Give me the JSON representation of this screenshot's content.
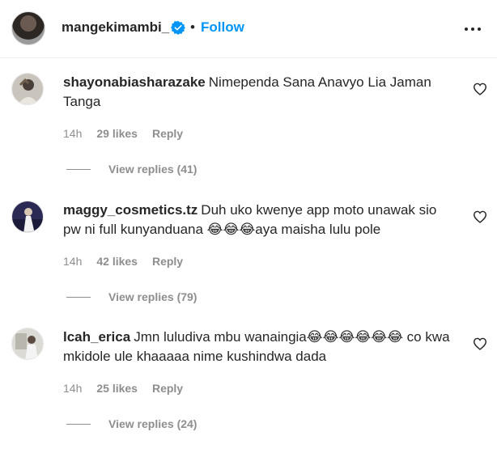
{
  "header": {
    "username": "mangekimambi_",
    "separator": "•",
    "follow_label": "Follow",
    "verified_icon": "verified-badge-icon",
    "more_icon": "more-options-icon"
  },
  "comments": [
    {
      "username": "shayonabiasharazake",
      "text": "Nimependa Sana Anavyo Lia Jaman Tanga",
      "time": "14h",
      "likes": "29 likes",
      "reply_label": "Reply",
      "view_replies": "View replies (41)"
    },
    {
      "username": "maggy_cosmetics.tz",
      "text": "Duh uko kwenye app moto unawak sio pw ni full kunyanduana 😂😂😂aya maisha lulu pole",
      "time": "14h",
      "likes": "42 likes",
      "reply_label": "Reply",
      "view_replies": "View replies (79)"
    },
    {
      "username": "lcah_erica",
      "text": "Jmn luludiva mbu wanaingia😂😂😂😂😂😂 co kwa mkidole ule khaaaaa nime kushindwa dada",
      "time": "14h",
      "likes": "25 likes",
      "reply_label": "Reply",
      "view_replies": "View replies (24)"
    }
  ],
  "colors": {
    "accent": "#0095f6",
    "text": "#262626",
    "muted": "#8e8e8e"
  }
}
